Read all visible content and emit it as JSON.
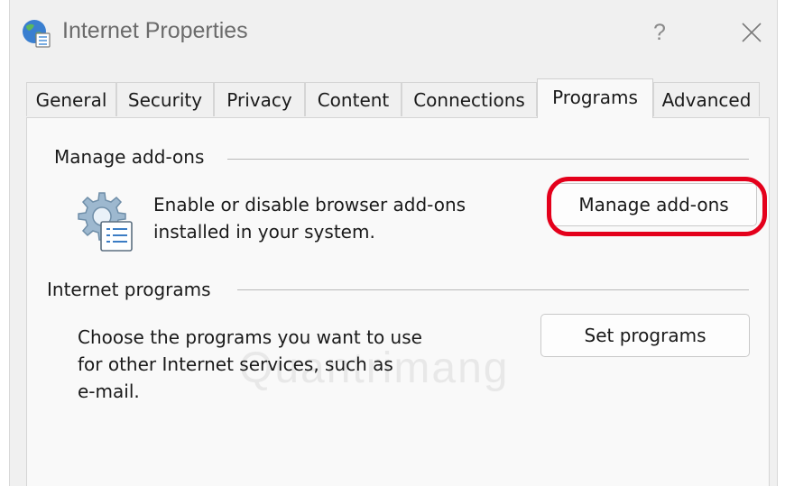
{
  "window": {
    "title": "Internet Properties",
    "title_icon": "internet-options-globe-icon",
    "help_label": "?",
    "close_icon": "close-icon"
  },
  "tabs": [
    {
      "label": "General",
      "active": false
    },
    {
      "label": "Security",
      "active": false
    },
    {
      "label": "Privacy",
      "active": false
    },
    {
      "label": "Content",
      "active": false
    },
    {
      "label": "Connections",
      "active": false
    },
    {
      "label": "Programs",
      "active": true
    },
    {
      "label": "Advanced",
      "active": false
    }
  ],
  "manage_addons": {
    "group_title": "Manage add-ons",
    "description_line1": "Enable or disable browser add-ons",
    "description_line2": "installed in your system.",
    "button_label": "Manage add-ons",
    "icon": "addons-gear-list-icon",
    "highlight_color": "#e4001b"
  },
  "internet_programs": {
    "group_title": "Internet programs",
    "description_line1": "Choose the programs you want to use",
    "description_line2": "for other Internet services, such as",
    "description_line3": "e-mail.",
    "button_label": "Set programs"
  },
  "watermark": "Quantrimang"
}
